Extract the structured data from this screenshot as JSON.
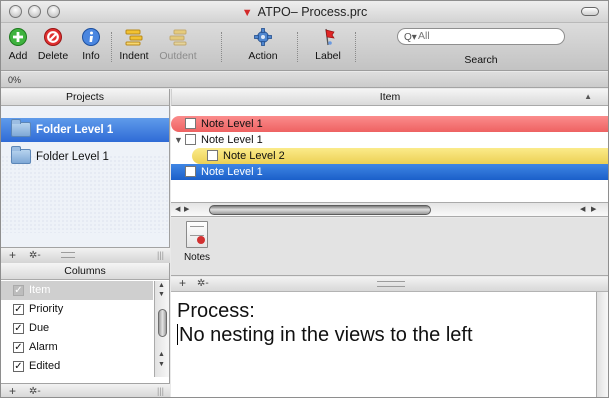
{
  "window": {
    "title": "ATPO– Process.prc"
  },
  "toolbar": {
    "add": "Add",
    "delete": "Delete",
    "info": "Info",
    "indent": "Indent",
    "outdent": "Outdent",
    "action": "Action",
    "label": "Label",
    "search_placeholder": "All",
    "search_label": "Search"
  },
  "progress": {
    "text": "0%",
    "value": 0
  },
  "projects": {
    "header": "Projects",
    "items": [
      {
        "label": "Folder Level 1",
        "selected": true
      },
      {
        "label": "Folder Level 1",
        "selected": false
      }
    ]
  },
  "columns": {
    "header": "Columns",
    "items": [
      {
        "label": "Item",
        "checked": true,
        "selected": true
      },
      {
        "label": "Priority",
        "checked": true,
        "selected": false
      },
      {
        "label": "Due",
        "checked": true,
        "selected": false
      },
      {
        "label": "Alarm",
        "checked": true,
        "selected": false
      },
      {
        "label": "Edited",
        "checked": true,
        "selected": false
      }
    ]
  },
  "outline": {
    "header": "Item",
    "rows": [
      {
        "label": "Note Level 1",
        "highlight": "#ee6262"
      },
      {
        "label": "Note Level 1",
        "expanded": true
      },
      {
        "label": "Note Level 2",
        "highlight": "#ecd055"
      },
      {
        "label": "Note Level 1",
        "selected": true
      }
    ]
  },
  "notes_tab": {
    "label": "Notes"
  },
  "notes": {
    "line1": "Process:",
    "line2": "No nesting in the views to the left"
  },
  "footer": {
    "plus": "+",
    "gear": "✲-"
  },
  "colors": {
    "selection": "#2f6bd6",
    "red_label": "#ee6262",
    "yellow_label": "#ecd055"
  }
}
